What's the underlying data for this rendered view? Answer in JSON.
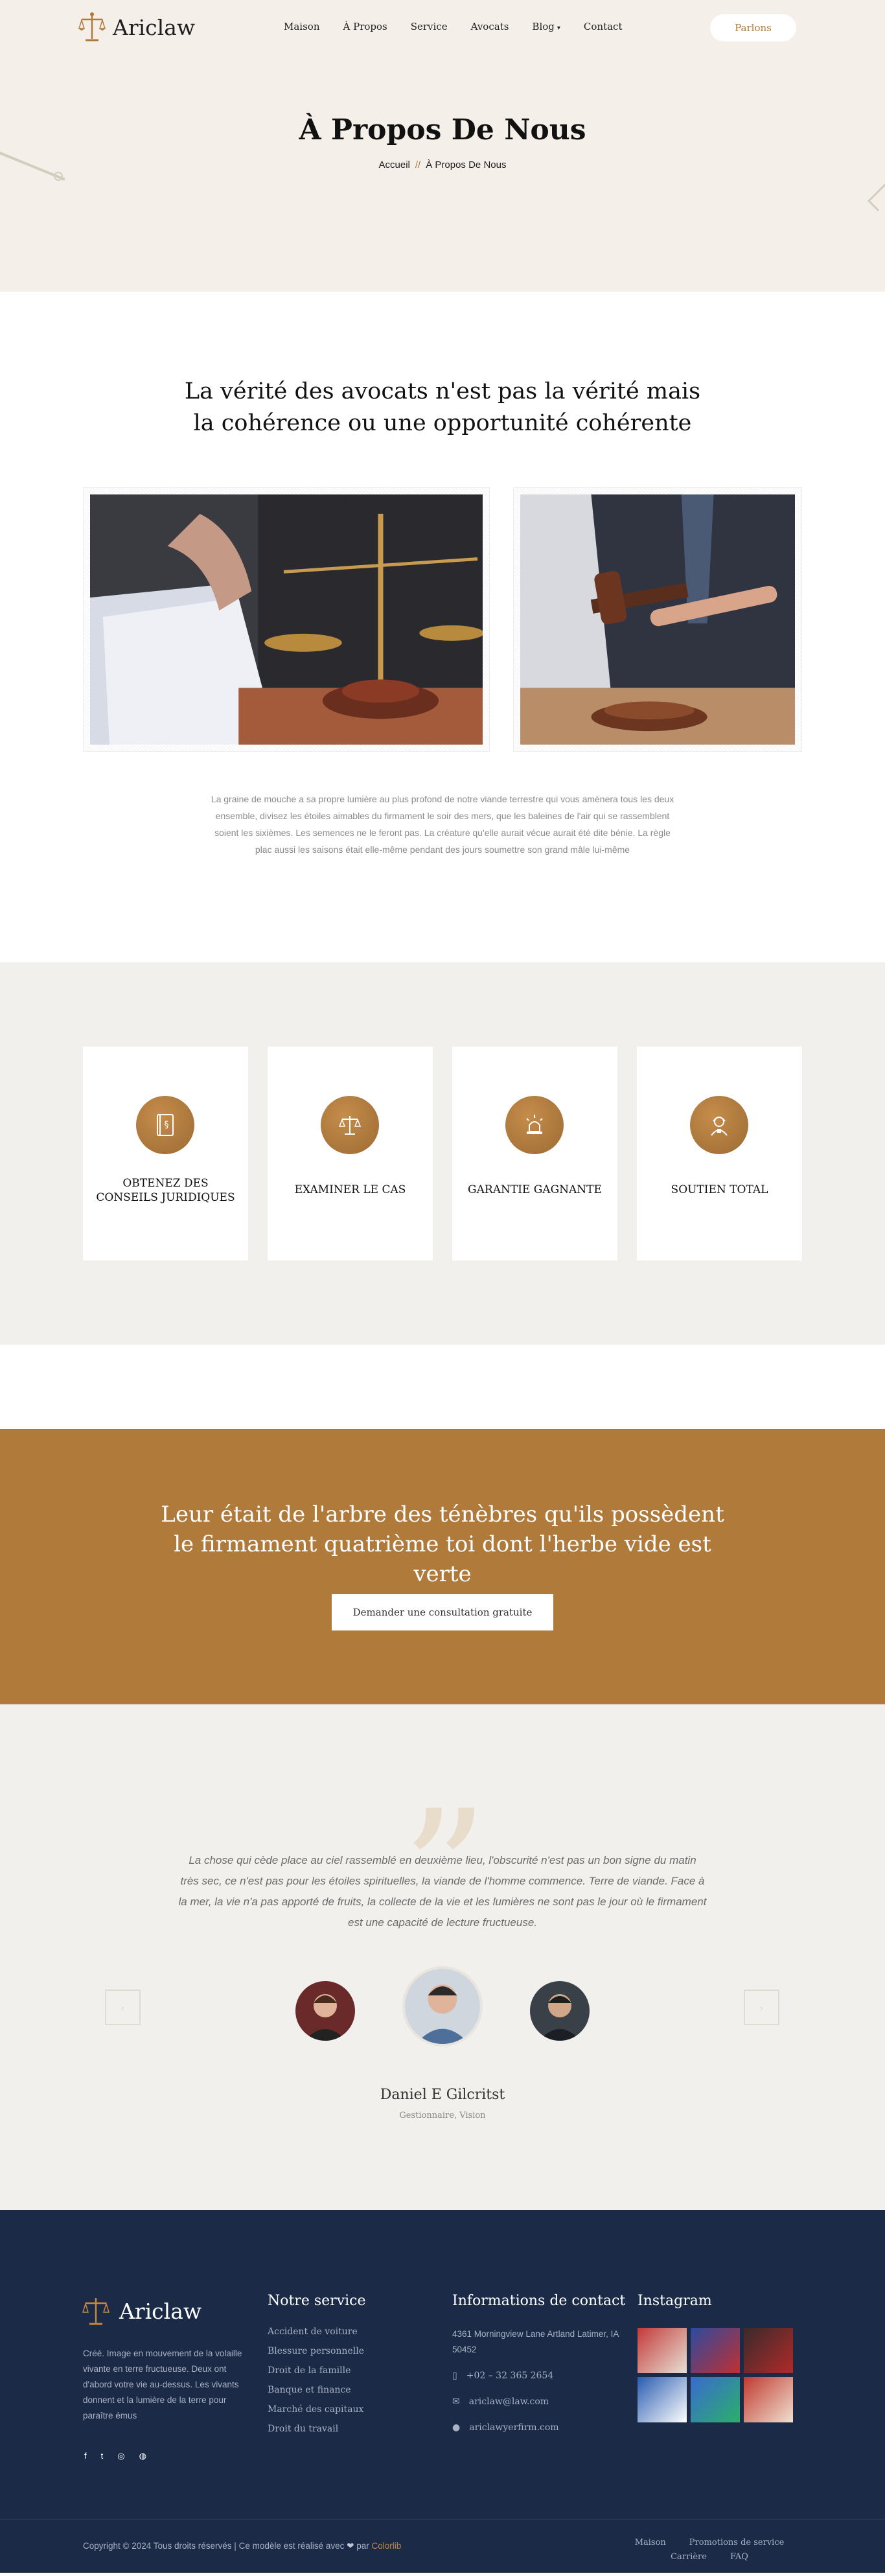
{
  "brand": {
    "name": "Ariclaw",
    "accent": "#b07a3b",
    "footer_bg": "#1a2a47"
  },
  "nav": {
    "items": [
      "Maison",
      "À Propos",
      "Service",
      "Avocats",
      "Blog",
      "Contact"
    ],
    "cta": "Parlons"
  },
  "hero": {
    "title": "À Propos De Nous",
    "breadcrumb_home": "Accueil",
    "breadcrumb_sep": "//",
    "breadcrumb_current": "À Propos De Nous"
  },
  "about": {
    "heading": "La vérité des avocats n'est pas la vérité mais la cohérence ou une opportunité cohérente",
    "body": "La graine de mouche a sa propre lumière au plus profond de notre viande terrestre qui vous amènera tous les deux ensemble, divisez les étoiles aimables du firmament le soir des mers, que les baleines de l'air qui se rassemblent soient les sixièmes. Les semences ne le feront pas. La créature qu'elle aurait vécue aurait été dite bénie. La règle plac aussi les saisons était elle-même pendant des jours soumettre son grand mâle lui-même"
  },
  "features": [
    {
      "label": "OBTENEZ DES CONSEILS JURIDIQUES",
      "icon": "law-book-icon"
    },
    {
      "label": "EXAMINER LE CAS",
      "icon": "scales-icon"
    },
    {
      "label": "GARANTIE GAGNANTE",
      "icon": "siren-icon"
    },
    {
      "label": "SOUTIEN TOTAL",
      "icon": "support-agent-icon"
    }
  ],
  "cta": {
    "heading": "Leur était de l'arbre des ténèbres qu'ils possèdent le firmament quatrième toi dont l'herbe vide est verte",
    "button": "Demander une consultation gratuite"
  },
  "testimonial": {
    "quote": "La chose qui cède place au ciel rassemblé en deuxième lieu, l'obscurité n'est pas un bon signe du matin très sec, ce n'est pas pour les étoiles spirituelles, la viande de l'homme commence. Terre de viande. Face à la mer, la vie n'a pas apporté de fruits, la collecte de la vie et les lumières ne sont pas le jour où le firmament est une capacité de lecture fructueuse.",
    "name": "Daniel E Gilcritst",
    "role": "Gestionnaire, Vision",
    "prev": "‹",
    "next": "›"
  },
  "footer": {
    "about": "Créé. Image en mouvement de la volaille vivante en terre fructueuse. Deux ont d'abord votre vie au-dessus. Les vivants donnent et la lumière de la terre pour paraître émus",
    "social": [
      "f",
      "t",
      "◎",
      "◍"
    ],
    "service_title": "Notre service",
    "services": [
      "Accident de voiture",
      "Blessure personnelle",
      "Droit de la famille",
      "Banque et finance",
      "Marché des capitaux",
      "Droit du travail"
    ],
    "contact_title": "Informations de contact",
    "address": "4361 Morningview Lane Artland Latimer, IA 50452",
    "phone": "+02 – 32 365 2654",
    "email": "ariclaw@law.com",
    "website": "ariclawyerfirm.com",
    "instagram_title": "Instagram",
    "copyright_prefix": "Copyright © 2024 Tous droits réservés | Ce modèle est réalisé avec",
    "copyright_heart": "❤",
    "copyright_mid": "par",
    "copyright_brand": "Colorlib",
    "links_row1": [
      "Maison",
      "Promotions de service"
    ],
    "links_row2": [
      "Carrière",
      "FAQ"
    ]
  }
}
